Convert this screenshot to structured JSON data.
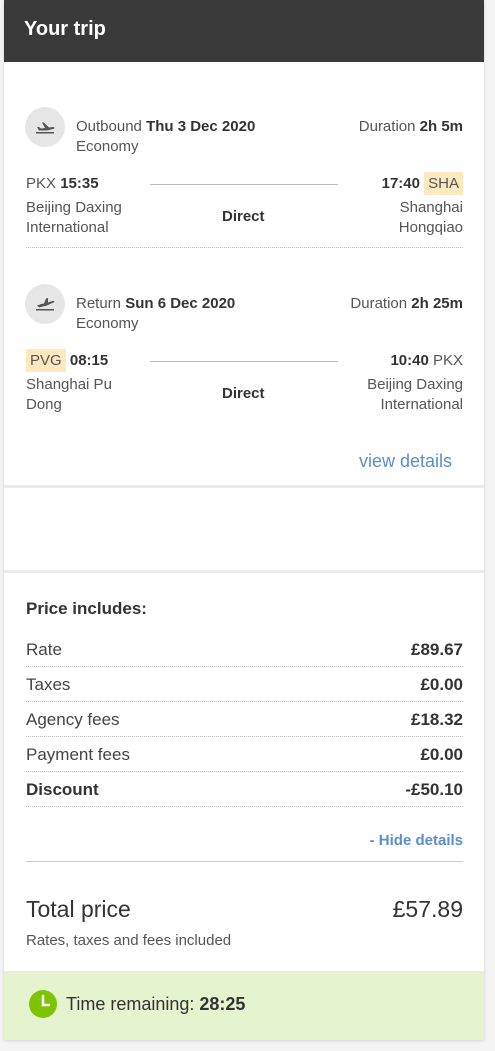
{
  "header": {
    "title": "Your trip"
  },
  "outbound": {
    "label": "Outbound",
    "date": "Thu 3 Dec 2020",
    "cabin": "Economy",
    "duration_label": "Duration",
    "duration": "2h 5m",
    "dep_code": "PKX",
    "dep_time": "15:35",
    "dep_airport_line1": "Beijing Daxing",
    "dep_airport_line2": "International",
    "arr_time": "17:40",
    "arr_code": "SHA",
    "arr_airport_line1": "Shanghai",
    "arr_airport_line2": "Hongqiao",
    "stops": "Direct"
  },
  "return": {
    "label": "Return",
    "date": "Sun 6 Dec 2020",
    "cabin": "Economy",
    "duration_label": "Duration",
    "duration": "2h 25m",
    "dep_code": "PVG",
    "dep_time": "08:15",
    "dep_airport_line1": "Shanghai Pu",
    "dep_airport_line2": "Dong",
    "arr_time": "10:40",
    "arr_code": "PKX",
    "arr_airport_line1": "Beijing Daxing",
    "arr_airport_line2": "International",
    "stops": "Direct"
  },
  "view_details": "view details",
  "price": {
    "heading": "Price includes:",
    "rows": [
      {
        "label": "Rate",
        "value": "£89.67"
      },
      {
        "label": "Taxes",
        "value": "£0.00"
      },
      {
        "label": "Agency fees",
        "value": "£18.32"
      },
      {
        "label": "Payment fees",
        "value": "£0.00"
      },
      {
        "label": "Discount",
        "value": "-£50.10"
      }
    ],
    "hide_details": "- Hide details",
    "total_label": "Total price",
    "total_value": "£57.89",
    "total_note": "Rates, taxes and fees included"
  },
  "timer": {
    "label": "Time remaining:",
    "value": "28:25"
  },
  "colors": {
    "header_bg": "#3a3a3a",
    "link": "#5b8ec9",
    "highlight": "#fde9c0",
    "timer_bg": "#e5f3cf",
    "timer_icon": "#7ec300"
  }
}
